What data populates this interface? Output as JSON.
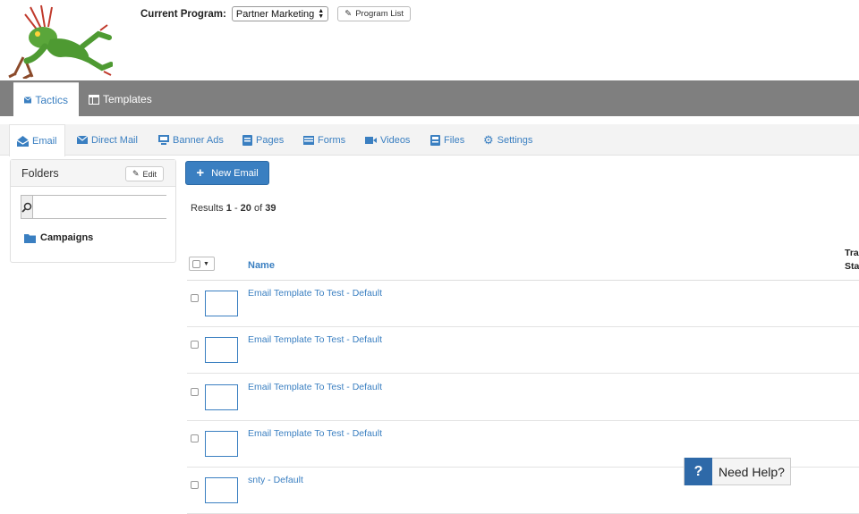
{
  "program": {
    "label": "Current Program:",
    "selected": "Partner Marketing",
    "list_button": "Program List"
  },
  "topnav": {
    "tabs": [
      {
        "label": "Tactics",
        "icon": "envelope-icon"
      },
      {
        "label": "Templates",
        "icon": "table-icon"
      }
    ]
  },
  "subnav": {
    "items": [
      {
        "label": "Email",
        "icon": "open-envelope-icon"
      },
      {
        "label": "Direct Mail",
        "icon": "envelope-icon"
      },
      {
        "label": "Banner Ads",
        "icon": "monitor-icon"
      },
      {
        "label": "Pages",
        "icon": "page-icon"
      },
      {
        "label": "Forms",
        "icon": "form-icon"
      },
      {
        "label": "Videos",
        "icon": "video-icon"
      },
      {
        "label": "Files",
        "icon": "file-icon"
      },
      {
        "label": "Settings",
        "icon": "gear-icon"
      }
    ]
  },
  "folders": {
    "title": "Folders",
    "edit_label": "Edit",
    "search_placeholder": "",
    "items": [
      {
        "label": "Campaigns"
      }
    ]
  },
  "actions": {
    "new_email": "New Email"
  },
  "results": {
    "prefix": "Results",
    "from": "1",
    "dash": "-",
    "to": "20",
    "of": "of",
    "total": "39"
  },
  "table": {
    "columns": {
      "name": "Name",
      "tra": "Tra",
      "sta": "Sta"
    },
    "rows": [
      {
        "name": "Email Template To Test - Default"
      },
      {
        "name": "Email Template To Test - Default"
      },
      {
        "name": "Email Template To Test - Default"
      },
      {
        "name": "Email Template To Test - Default"
      },
      {
        "name": "snty - Default"
      }
    ]
  },
  "help": {
    "symbol": "?",
    "label": "Need Help?"
  },
  "colors": {
    "accent": "#3a7fc1",
    "nav_bar": "#7f7f7f",
    "help_blue": "#2e69a8"
  }
}
